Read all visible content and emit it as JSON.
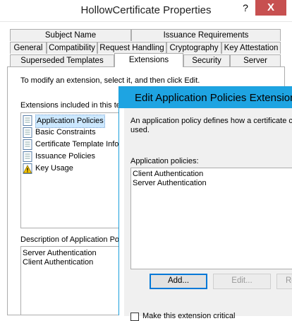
{
  "parent": {
    "title": "HollowCertificate Properties",
    "help_label": "?",
    "close_label": "X",
    "tabs_row1": [
      "Subject Name",
      "Issuance Requirements"
    ],
    "tabs_row2": [
      "General",
      "Compatibility",
      "Request Handling",
      "Cryptography",
      "Key Attestation"
    ],
    "tabs_row3": [
      "Superseded Templates",
      "Extensions",
      "Security",
      "Server"
    ],
    "active_tab": "Extensions",
    "instructions": "To modify an extension, select it, and then click Edit.",
    "extensions_label": "Extensions included in this te",
    "extensions": [
      {
        "label": "Application Policies",
        "icon": "document-icon",
        "selected": true
      },
      {
        "label": "Basic Constraints",
        "icon": "document-icon"
      },
      {
        "label": "Certificate Template Infor",
        "icon": "document-icon"
      },
      {
        "label": "Issuance Policies",
        "icon": "document-icon"
      },
      {
        "label": "Key Usage",
        "icon": "warning-icon"
      }
    ],
    "description_label": "Description of Application Pol",
    "description_lines": [
      "Server Authentication",
      "Client Authentication"
    ]
  },
  "dialog": {
    "title": "Edit Application Policies Extension",
    "description": [
      "An application policy defines how a certificate ca",
      "used."
    ],
    "policies_label": "Application policies:",
    "policies": [
      "Client Authentication",
      "Server Authentication"
    ],
    "buttons": {
      "add": "Add...",
      "edit": "Edit...",
      "remove": "Re"
    },
    "critical_label": "Make this extension critical",
    "critical_checked": false
  },
  "colors": {
    "titlebar_active": "#1ea4e2",
    "close_button": "#c75050",
    "selection": "#cce8ff"
  }
}
